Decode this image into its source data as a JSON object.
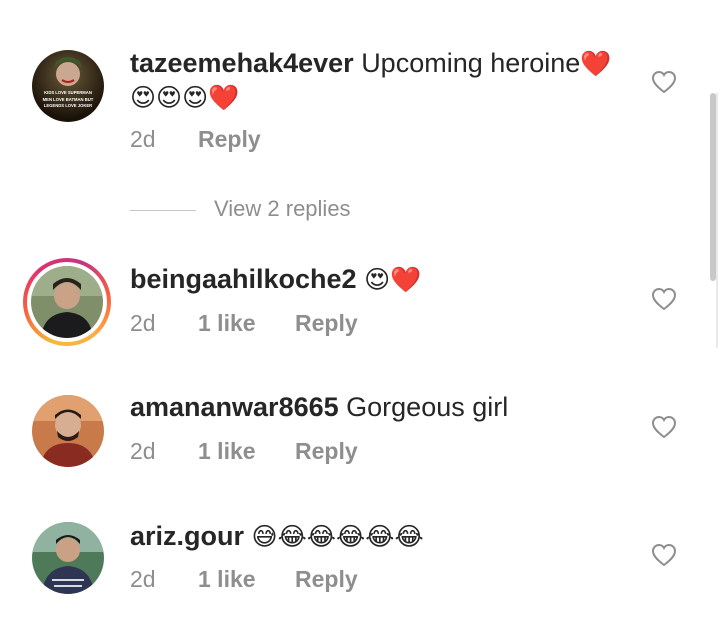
{
  "comments": [
    {
      "username": "tazeemehak4ever",
      "text": "Upcoming heroine",
      "emojis_line1": "❤️",
      "emojis_line2": "😍😍😍❤️",
      "age": "2d",
      "reply": "Reply",
      "avatar_caption": "KIDS LOVE SUPERMAN / MEN LOVE BATMAN BUT / LEGENDS LOVE JOKER"
    },
    {
      "username": "beingaahilkoche2",
      "text": "",
      "emojis": "😍❤️",
      "age": "2d",
      "likes": "1 like",
      "reply": "Reply"
    },
    {
      "username": "amananwar8665",
      "text": "Gorgeous girl",
      "age": "2d",
      "likes": "1 like",
      "reply": "Reply"
    },
    {
      "username": "ariz.gour",
      "text": "",
      "emojis": "😅😂😂😂😂😂",
      "age": "2d",
      "likes": "1 like",
      "reply": "Reply"
    }
  ],
  "view_replies": "View 2 replies",
  "icons": {
    "like": "heart-outline-icon"
  },
  "colors": {
    "username": "#262626",
    "meta": "#8e8e8e",
    "heart_stroke": "#8e8e8e",
    "emoji_heart": "#e0245e"
  }
}
